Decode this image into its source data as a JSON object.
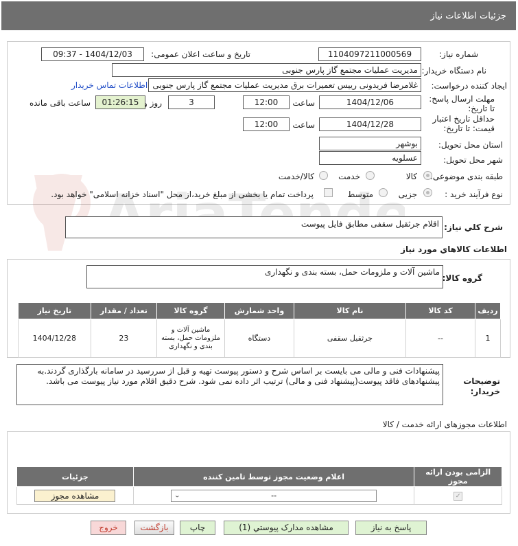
{
  "header": {
    "title": "جزئیات اطلاعات نیاز"
  },
  "form": {
    "need_number_label": "شماره نیاز:",
    "need_number": "1104097211000569",
    "announce_label": "تاریخ و ساعت اعلان عمومی:",
    "announce_value": "1404/12/03 - 09:37",
    "buyer_label": "نام دستگاه خریدار:",
    "buyer": "مدیریت عملیات مجتمع گاز پارس جنوبی",
    "creator_label": "ایجاد کننده درخواست:",
    "creator": "غلامرضا فریدونی رییس تعمیرات برق مدیریت عملیات مجتمع گاز پارس جنوبی",
    "contact_link": "اطلاعات تماس خریدار",
    "deadline_label": "مهلت ارسال پاسخ: تا تاریخ:",
    "deadline_date": "1404/12/06",
    "time_label": "ساعت",
    "deadline_time": "12:00",
    "days_value": "3",
    "days_label": "روز و",
    "remaining": "01:26:15",
    "remaining_label": "ساعت باقی مانده",
    "validity_label": "حداقل تاریخ اعتبار قیمت: تا تاریخ:",
    "validity_date": "1404/12/28",
    "validity_time": "12:00",
    "province_label": "استان محل تحویل:",
    "province": "بوشهر",
    "city_label": "شهر محل تحویل:",
    "city": "عسلویه",
    "category_label": "طبقه بندی موضوعی:",
    "category_options": [
      "کالا",
      "خدمت",
      "کالا/خدمت"
    ],
    "process_label": "نوع فرآیند خرید :",
    "process_options": [
      "جزیی",
      "متوسط"
    ],
    "payment_note": "پرداخت تمام یا بخشی از مبلغ خرید،از محل \"اسناد خزانه اسلامی\" خواهد بود."
  },
  "summary": {
    "label": "شرح کلي نياز:",
    "text": "اقلام جرثقیل سقفی مطابق فایل پیوست"
  },
  "goods_section": {
    "title": "اطلاعات کالاهاي مورد نياز",
    "group_label": "گروه کالا:",
    "group_value": "ماشین آلات و ملزومات حمل، بسته بندی و نگهداری",
    "columns": [
      "ردیف",
      "کد کالا",
      "نام کالا",
      "واحد شمارش",
      "گروه کالا",
      "تعداد / مقدار",
      "تاریخ نیاز"
    ],
    "rows": [
      {
        "row": "1",
        "code": "--",
        "name": "جرثقیل سقفی",
        "unit": "دستگاه",
        "group": "ماشین آلات و ملزومات حمل، بسته بندی و نگهداری",
        "qty": "23",
        "date": "1404/12/28"
      }
    ]
  },
  "buyer_notes": {
    "label": "توضیحات خریدار:",
    "text": "پیشنهادات فنی و مالی می بایست بر اساس شرح و دستور پیوست تهیه و قبل از سررسید در سامانه بارگذاری گردند.به پیشنهادهای فاقد پیوست(پیشنهاد فنی و مالی) ترتیب اثر داده نمی شود. شرح دقیق اقلام مورد نیاز پیوست می باشد."
  },
  "permits": {
    "title": "اطلاعات مجوزهای ارائه خدمت / کالا",
    "columns": [
      "الزامی بودن ارائه مجوز",
      "اعلام وضعیت مجوز توسط تامین کننده",
      "جزئیات"
    ],
    "select_value": "--",
    "view_button": "مشاهده مجوز"
  },
  "footer": {
    "reply": "پاسخ به نیاز",
    "docs": "مشاهده مدارک پیوستي (1)",
    "print": "چاپ",
    "back": "بازگشت",
    "exit": "خروج"
  },
  "watermark": {
    "text": "AriaTender.neT"
  },
  "colors": {
    "header_bg": "#6f6f6f",
    "remaining_bg": "#e4f2cf",
    "link": "#2450c8",
    "exit_bg": "#f8d8d8",
    "back_text": "#c0392b"
  }
}
